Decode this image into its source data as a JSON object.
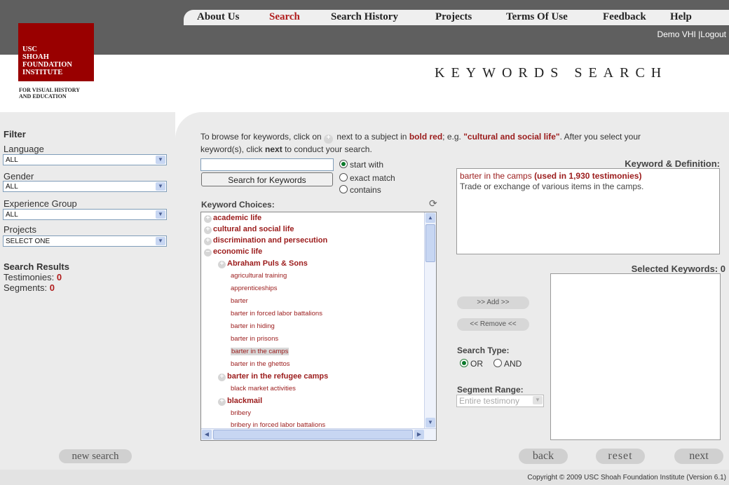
{
  "nav": {
    "items": [
      "About Us",
      "Search",
      "Search History",
      "Projects",
      "Terms Of Use",
      "Feedback",
      "Help"
    ],
    "active": "Search"
  },
  "user": {
    "name": "Demo VHI",
    "separator": "|",
    "logout": "Logout"
  },
  "logo": {
    "line1": "USC",
    "line2": "SHOAH",
    "line3": "FOUNDATION",
    "line4": "INSTITUTE",
    "sub1": "FOR VISUAL HISTORY",
    "sub2": "AND EDUCATION"
  },
  "page_title": "KEYWORDS SEARCH",
  "filter": {
    "title": "Filter",
    "language_label": "Language",
    "language_value": "ALL",
    "gender_label": "Gender",
    "gender_value": "ALL",
    "experience_label": "Experience Group",
    "experience_value": "ALL",
    "projects_label": "Projects",
    "projects_value": "SELECT ONE"
  },
  "results": {
    "title": "Search Results",
    "testimonies_label": "Testimonies:",
    "testimonies_value": "0",
    "segments_label": "Segments:",
    "segments_value": "0"
  },
  "new_search_label": "new search",
  "instructions": {
    "part1": "To browse for keywords, click on",
    "part2": "next to a subject in",
    "bold_red": "bold red",
    "part3": "; e.g.",
    "example": "\"cultural and social life\"",
    "part4": ". After you select your",
    "line2a": "keyword(s), click",
    "next_word": "next",
    "line2b": "to conduct your search."
  },
  "keyword_search": {
    "input_value": "",
    "button_label": "Search for Keywords",
    "match_options": [
      "start with",
      "exact match",
      "contains"
    ],
    "selected_option": "start with"
  },
  "keyword_choices": {
    "title": "Keyword Choices:",
    "items": [
      {
        "label": "academic life",
        "level": 0,
        "bold": true,
        "toggle": "+"
      },
      {
        "label": "cultural and social life",
        "level": 0,
        "bold": true,
        "toggle": "+"
      },
      {
        "label": "discrimination and persecution",
        "level": 0,
        "bold": true,
        "toggle": "+"
      },
      {
        "label": "economic life",
        "level": 0,
        "bold": true,
        "toggle": "−"
      },
      {
        "label": "Abraham Puls & Sons",
        "level": 1,
        "bold": true,
        "toggle": "+"
      },
      {
        "label": "agricultural training",
        "level": 2,
        "bold": false
      },
      {
        "label": "apprenticeships",
        "level": 2,
        "bold": false
      },
      {
        "label": "barter",
        "level": 2,
        "bold": false
      },
      {
        "label": "barter in forced labor battalions",
        "level": 2,
        "bold": false
      },
      {
        "label": "barter in hiding",
        "level": 2,
        "bold": false
      },
      {
        "label": "barter in prisons",
        "level": 2,
        "bold": false
      },
      {
        "label": "barter in the camps",
        "level": 2,
        "bold": false,
        "highlighted": true
      },
      {
        "label": "barter in the ghettos",
        "level": 2,
        "bold": false
      },
      {
        "label": "barter in the refugee camps",
        "level": 1,
        "bold": true,
        "toggle": "+"
      },
      {
        "label": "black market activities",
        "level": 2,
        "bold": false
      },
      {
        "label": "blackmail",
        "level": 1,
        "bold": true,
        "toggle": "+"
      },
      {
        "label": "bribery",
        "level": 2,
        "bold": false
      },
      {
        "label": "bribery in forced labor battalions",
        "level": 2,
        "bold": false
      }
    ]
  },
  "definition": {
    "title": "Keyword & Definition:",
    "keyword": "barter in the camps",
    "usage": "(used in 1,930 testimonies)",
    "text": "Trade or exchange of various items in the camps."
  },
  "selected_keywords": {
    "title": "Selected Keywords:",
    "count": "0"
  },
  "actions": {
    "add": ">> Add >>",
    "remove": "<< Remove <<"
  },
  "search_type": {
    "title": "Search Type:",
    "options": [
      "OR",
      "AND"
    ],
    "selected": "OR"
  },
  "segment_range": {
    "title": "Segment Range:",
    "value": "Entire testimony"
  },
  "bottom_buttons": {
    "back": "back",
    "reset": "reset",
    "next": "next"
  },
  "copyright": "Copyright © 2009 USC Shoah Foundation Institute (Version 6.1)",
  "colors": {
    "accent_red": "#990000",
    "link_red": "#9b1b1b",
    "header_gray": "#5f5f5f",
    "panel_gray": "#ebebeb"
  }
}
